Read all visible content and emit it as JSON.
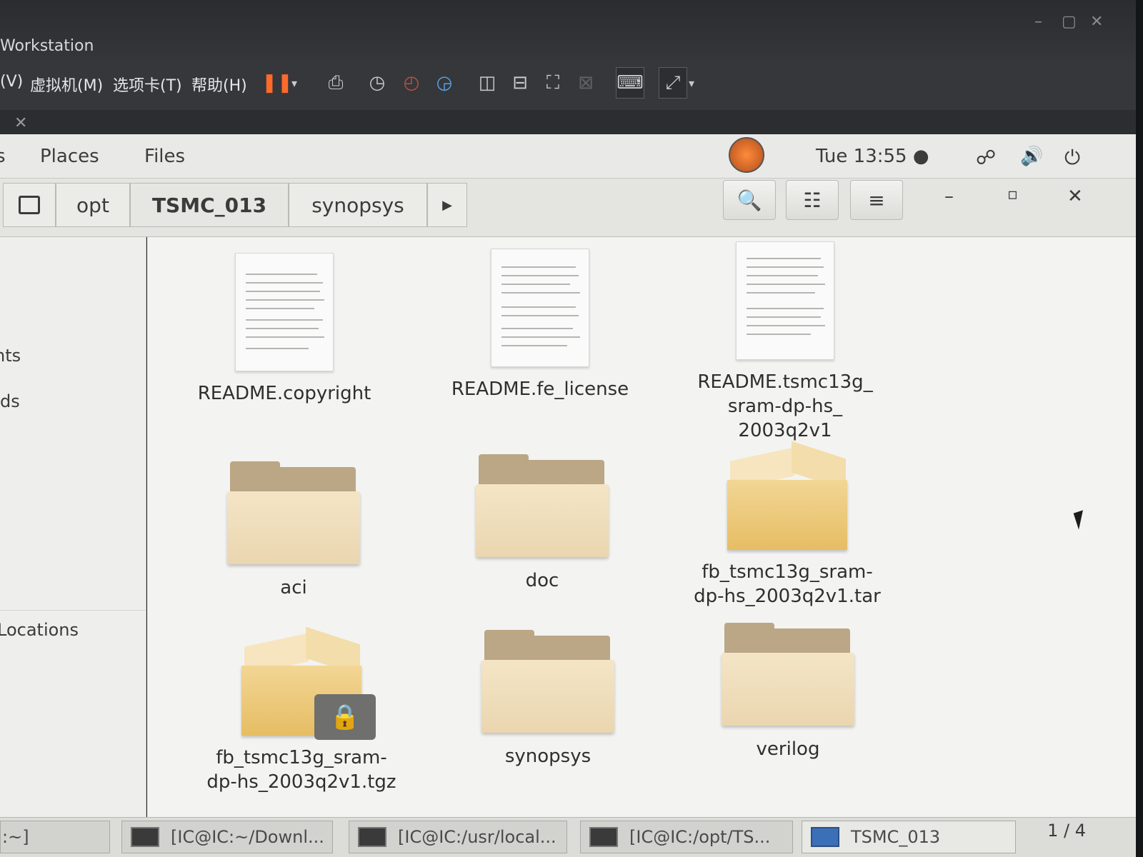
{
  "vmware": {
    "title": "Workstation",
    "menus": [
      "(V)",
      "虚拟机(M)",
      "选项卡(T)",
      "帮助(H)"
    ],
    "vm_tab_close": "✕"
  },
  "gnome_top": {
    "items": [
      "s",
      "Places",
      "Files"
    ],
    "clock": "Tue 13:55 ●"
  },
  "breadcrumb": {
    "segments": [
      "opt",
      "TSMC_013",
      "synopsys"
    ],
    "next_arrow": "▶"
  },
  "header_buttons": {
    "search_icon": "🔍",
    "view_icon": "☷",
    "menu_icon": "≡",
    "minimize": "–",
    "maximize": "▫",
    "close": "✕"
  },
  "sidebar": {
    "items": [
      "nts",
      "ds",
      "Locations"
    ]
  },
  "files": [
    {
      "name": "README.copyright",
      "kind": "document"
    },
    {
      "name": "README.fe_license",
      "kind": "document"
    },
    {
      "name": "README.tsmc13g_\nsram-dp-hs_\n2003q2v1",
      "kind": "document"
    },
    {
      "name": "aci",
      "kind": "folder"
    },
    {
      "name": "doc",
      "kind": "folder"
    },
    {
      "name": "fb_tsmc13g_sram-\ndp-hs_2003q2v1.tar",
      "kind": "archive"
    },
    {
      "name": "fb_tsmc13g_sram-\ndp-hs_2003q2v1.tgz",
      "kind": "archive-locked"
    },
    {
      "name": "synopsys",
      "kind": "folder"
    },
    {
      "name": "verilog",
      "kind": "folder"
    }
  ],
  "taskbar": {
    "tasks": [
      ":~]",
      "[IC@IC:~/Downl...",
      "[IC@IC:/usr/local...",
      "[IC@IC:/opt/TS...",
      "TSMC_013"
    ],
    "pager": "1 / 4"
  }
}
